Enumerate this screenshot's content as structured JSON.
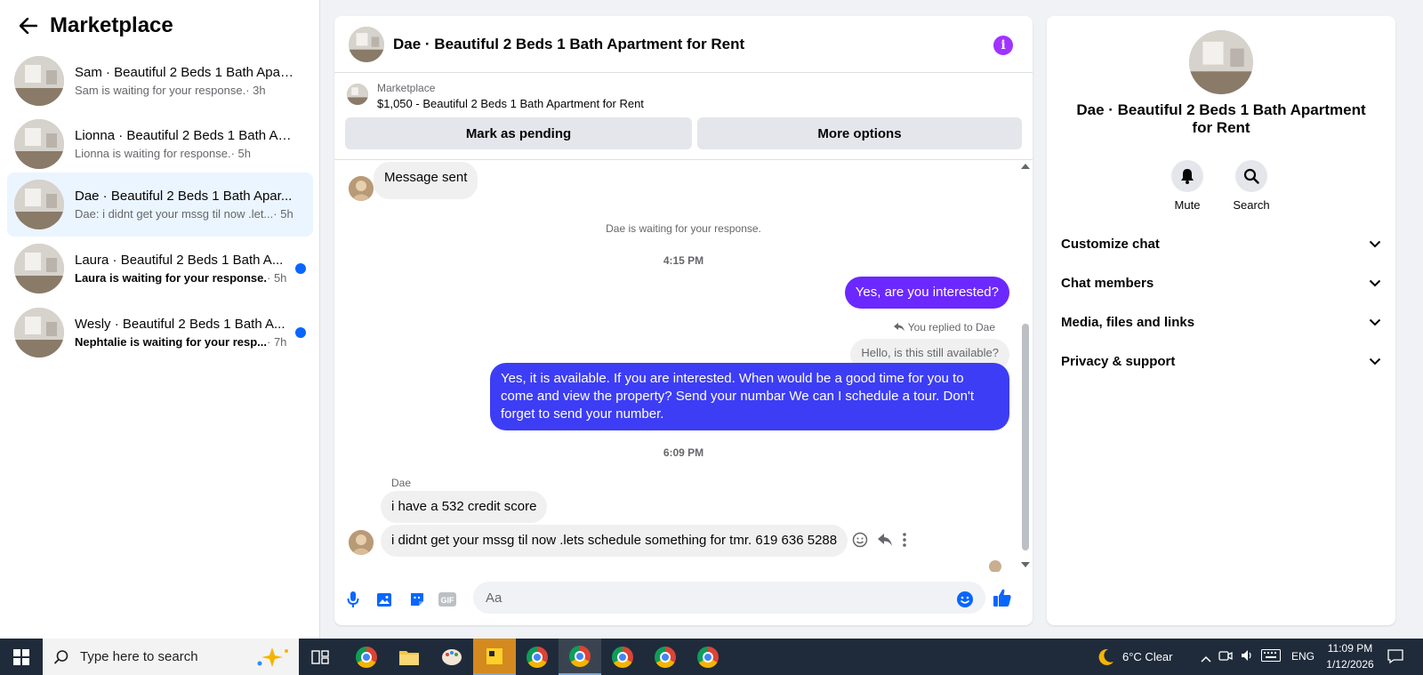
{
  "sidebar": {
    "title": "Marketplace",
    "conversations": [
      {
        "title": "Sam · Beautiful 2 Beds 1 Bath Apar...",
        "snippet": "Sam is waiting for your response.",
        "time": " · 3h",
        "unread": false,
        "active": false
      },
      {
        "title": "Lionna · Beautiful 2 Beds 1 Bath Ap...",
        "snippet": "Lionna is waiting for response.",
        "time": " · 5h",
        "unread": false,
        "active": false
      },
      {
        "title": "Dae · Beautiful 2 Beds 1 Bath Apar...",
        "snippet": "Dae: i didnt get your mssg til now .let...",
        "time": " · 5h",
        "unread": false,
        "active": true
      },
      {
        "title": "Laura · Beautiful 2 Beds 1 Bath A...",
        "snippet": "Laura is waiting for your response.",
        "time": " · 5h",
        "unread": true,
        "active": false
      },
      {
        "title": "Wesly · Beautiful 2 Beds 1 Bath A...",
        "snippet": "Nephtalie is waiting for your resp...",
        "time": " · 7h",
        "unread": true,
        "active": false
      }
    ]
  },
  "chat": {
    "title": "Dae · Beautiful 2 Beds 1 Bath Apartment for Rent",
    "listing_source": "Marketplace",
    "listing_price_title": "$1,050 - Beautiful 2 Beds 1 Bath Apartment for Rent",
    "mark_pending_label": "Mark as pending",
    "more_options_label": "More options",
    "messages": {
      "message_sent": "Message sent",
      "waiting_notice": "Dae is waiting for your response.",
      "time_1": "4:15 PM",
      "out_1": "Yes, are you interested?",
      "replied_to": "You replied to Dae",
      "quoted": "Hello, is this still available?",
      "out_2": "Yes, it is available. If you are interested.   When would be a good time for you to come and view the property? Send your numbar We can I schedule a tour.  Don't forget to send your number.",
      "time_2": "6:09 PM",
      "sender_name": "Dae",
      "in_1": "i have a 532 credit score",
      "in_2": "i didnt get your mssg til now .lets  schedule something for tmr. 619 636 5288"
    },
    "composer_placeholder": "Aa"
  },
  "details": {
    "title": "Dae · Beautiful 2 Beds 1 Bath Apartment for Rent",
    "mute_label": "Mute",
    "search_label": "Search",
    "sections": [
      "Customize chat",
      "Chat members",
      "Media, files and links",
      "Privacy & support"
    ]
  },
  "taskbar": {
    "search_placeholder": "Type here to search",
    "weather": "6°C  Clear",
    "language": "ENG",
    "time": "11:09 PM",
    "date": "1/12/2026"
  },
  "colors": {
    "accent_purple": "#6b28ff",
    "accent_blue": "#3d3df5",
    "unread_dot": "#0866ff",
    "active_row": "#ebf5ff"
  }
}
